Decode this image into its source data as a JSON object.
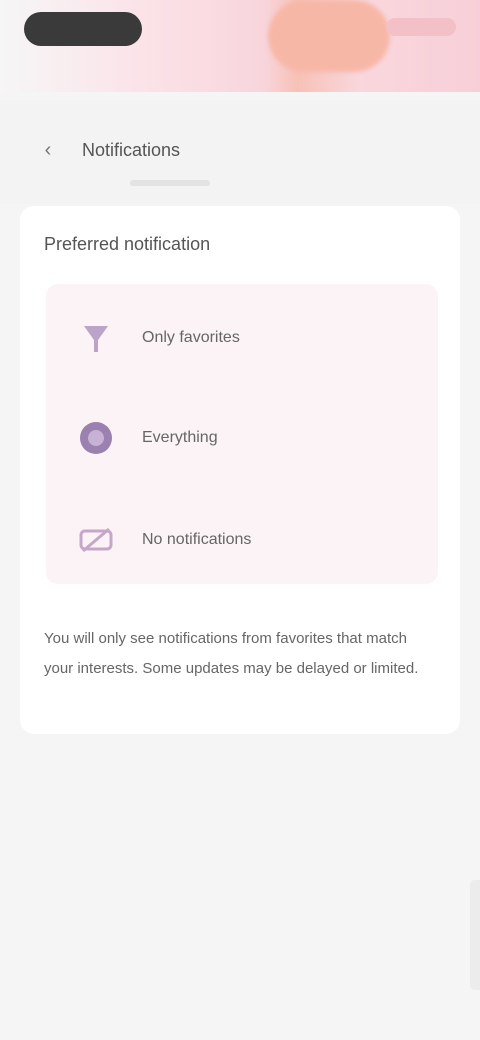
{
  "status_bar": {
    "left_pill": "",
    "right_text": ""
  },
  "header": {
    "back_icon": "arrow-left-icon",
    "title": "Notifications"
  },
  "card": {
    "section_title": "Preferred notification",
    "options": [
      {
        "icon": "funnel-icon",
        "label": "Only favorites"
      },
      {
        "icon": "star-icon",
        "label": "Everything"
      },
      {
        "icon": "mute-icon",
        "label": "No notifications"
      }
    ],
    "note": "You will only see notifications from favorites that match your interests. Some updates may be delayed or limited."
  },
  "colors": {
    "accent": "#8a6ca2",
    "option_bg": "#fbf3f6",
    "banner_pink": "#f8d5dc",
    "banner_coral": "#f7b7a7"
  }
}
